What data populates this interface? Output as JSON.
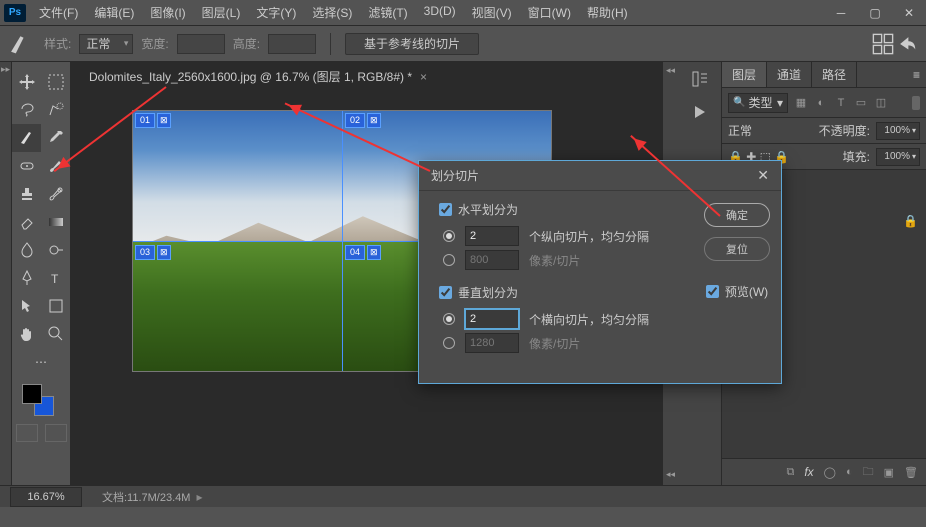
{
  "menu": [
    "文件(F)",
    "编辑(E)",
    "图像(I)",
    "图层(L)",
    "文字(Y)",
    "选择(S)",
    "滤镜(T)",
    "3D(D)",
    "视图(V)",
    "窗口(W)",
    "帮助(H)"
  ],
  "optbar": {
    "style_lbl": "样式:",
    "style_val": "正常",
    "width_lbl": "宽度:",
    "height_lbl": "高度:",
    "guide_btn": "基于参考线的切片"
  },
  "tab": {
    "title": "Dolomites_Italy_2560x1600.jpg @ 16.7% (图层 1, RGB/8#) *"
  },
  "slices": {
    "s1": "01",
    "s2": "02",
    "s3": "03",
    "s4": "04"
  },
  "rpanel": {
    "tabs": [
      "图层",
      "通道",
      "路径"
    ],
    "filter_lbl": "类型",
    "mode": "正常",
    "opacity_lbl": "不透明度:",
    "opacity_val": "100%",
    "fill_lbl": "填充:",
    "fill_val": "100%"
  },
  "status": {
    "zoom": "16.67%",
    "docinfo": "文档:11.7M/23.4M"
  },
  "dialog": {
    "title": "划分切片",
    "h_chk": "水平划分为",
    "h_count": "2",
    "h_count_suffix": "个纵向切片，均匀分隔",
    "h_px": "800",
    "h_px_suffix": "像素/切片",
    "v_chk": "垂直划分为",
    "v_count": "2",
    "v_count_suffix": "个横向切片，均匀分隔",
    "v_px": "1280",
    "v_px_suffix": "像素/切片",
    "ok": "确定",
    "reset": "复位",
    "preview": "预览(W)"
  }
}
